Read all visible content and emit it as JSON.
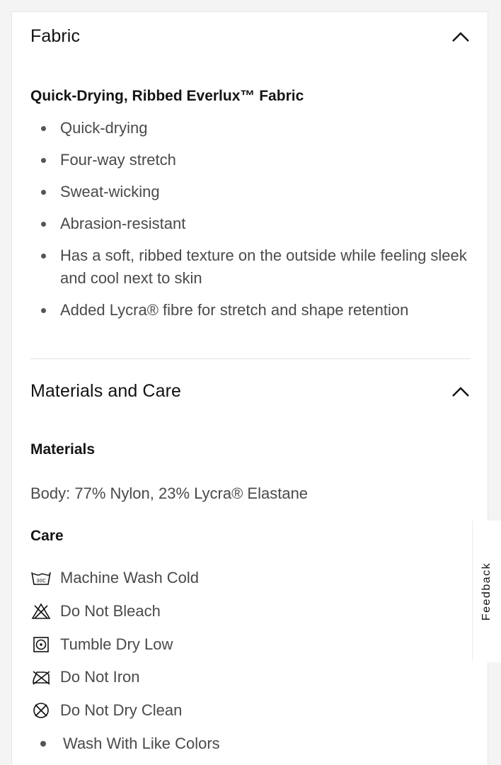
{
  "fabric": {
    "title": "Fabric",
    "subtitle": "Quick-Drying, Ribbed Everlux™ Fabric",
    "features": [
      "Quick-drying",
      "Four-way stretch",
      "Sweat-wicking",
      "Abrasion-resistant",
      "Has a soft, ribbed texture on the outside while feeling sleek and cool next to skin",
      "Added Lycra® fibre for stretch and shape retention"
    ]
  },
  "materials_care": {
    "title": "Materials and Care",
    "materials_heading": "Materials",
    "body": "Body: 77% Nylon, 23% Lycra® Elastane",
    "care_heading": "Care",
    "care_items": [
      {
        "label": "Machine Wash Cold",
        "icon": "wash-30-icon"
      },
      {
        "label": "Do Not Bleach",
        "icon": "no-bleach-icon"
      },
      {
        "label": "Tumble Dry Low",
        "icon": "tumble-dry-low-icon"
      },
      {
        "label": "Do Not Iron",
        "icon": "no-iron-icon"
      },
      {
        "label": "Do Not Dry Clean",
        "icon": "no-dry-clean-icon"
      },
      {
        "label": "Wash With Like Colors",
        "icon": "bullet"
      }
    ]
  },
  "feedback": {
    "label": "Feedback"
  },
  "wash_temp_label": "30C"
}
